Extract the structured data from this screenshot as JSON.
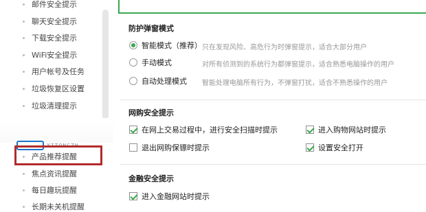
{
  "sidebar": {
    "items": [
      {
        "label": "邮件安全提示"
      },
      {
        "label": "聊天安全提示"
      },
      {
        "label": "下载安全提示"
      },
      {
        "label": "WiFi安全提示"
      },
      {
        "label": "用户帐号及任务"
      },
      {
        "label": "垃圾恢复区设置"
      },
      {
        "label": "垃圾清理提示"
      },
      {
        "label": "产品推荐提醒"
      },
      {
        "label": "焦点资讯提醒"
      },
      {
        "label": "每日趣玩提醒"
      },
      {
        "label": "长期未关机提醒"
      }
    ],
    "highlighted_item": "产品推荐提醒"
  },
  "sections": {
    "popup_mode": {
      "title": "防护弹窗模式",
      "options": [
        {
          "label": "智能模式（推荐）",
          "desc": "只在发现风险、高危行为时弹窗提示，适合大部分用户",
          "selected": true
        },
        {
          "label": "手动模式",
          "desc": "对所有侦测到的系统行为都弹窗提示，适合熟悉电脑操作的用户",
          "selected": false
        },
        {
          "label": "自动处理模式",
          "desc": "智能处理电脑所有行为，不弹窗打扰，适合不熟悉操作的用户",
          "selected": false
        }
      ]
    },
    "shopping": {
      "title": "网购安全提示",
      "options": [
        {
          "label": "在网上交易过程中，进行安全扫描时提示",
          "checked": true
        },
        {
          "label": "进入购物网站时提示",
          "checked": true
        },
        {
          "label": "退出网购保镖时提示",
          "checked": false
        },
        {
          "label": "设置安全打开",
          "checked": true
        }
      ]
    },
    "finance": {
      "title": "金融安全提示",
      "options": [
        {
          "label": "进入金融网站时提示",
          "checked": true
        }
      ]
    }
  },
  "watermark": {
    "text": "XITONGZH"
  },
  "colors": {
    "accent": "#3aa84f",
    "highlight": "#b22b2b"
  }
}
